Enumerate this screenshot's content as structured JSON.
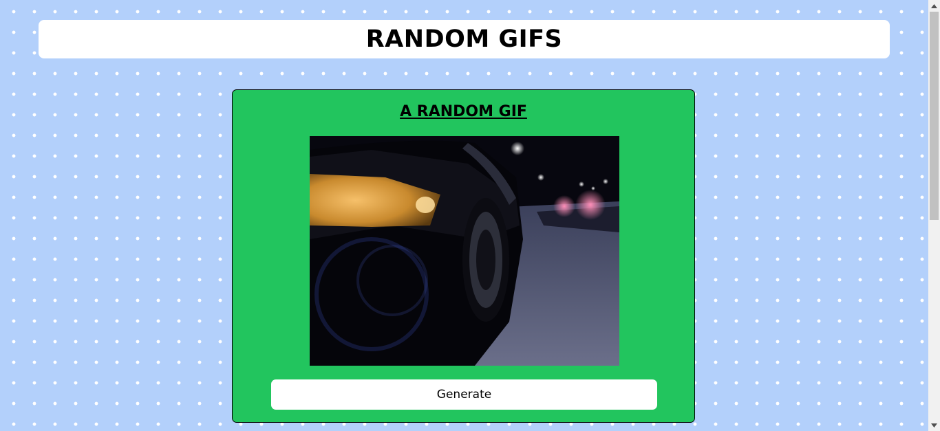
{
  "header": {
    "title": "RANDOM GIFS"
  },
  "card": {
    "title": "A RANDOM GIF",
    "gif_description": "night-driving-car-gif",
    "generate_label": "Generate",
    "background_color": "#22c55e"
  },
  "page": {
    "background_color": "#b3d0fb",
    "dot_color": "#ffffff"
  }
}
